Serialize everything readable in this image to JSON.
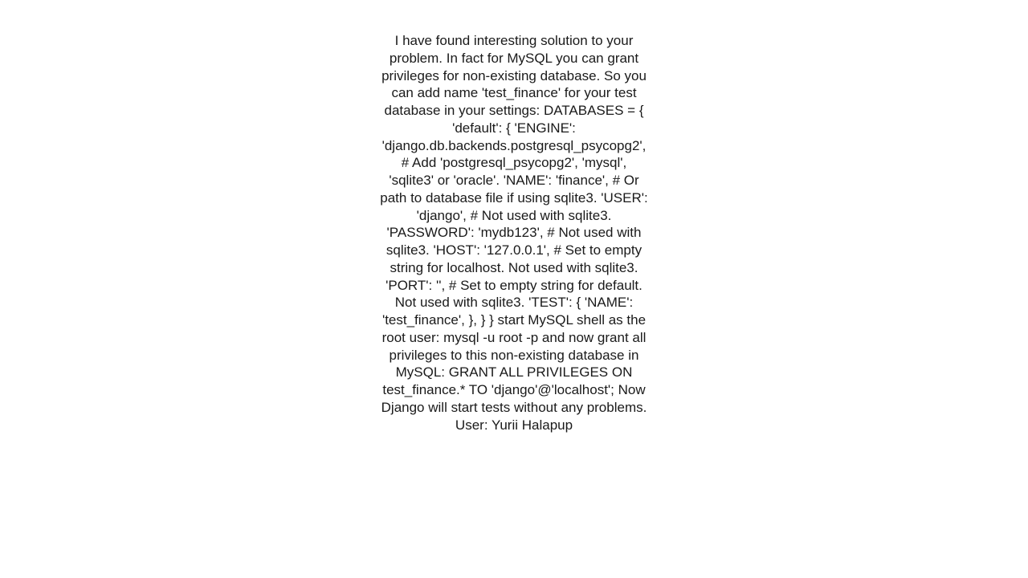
{
  "document": {
    "body": "I have found interesting solution to your problem.  In fact for MySQL you can grant privileges for non-existing database. So you can add name 'test_finance' for your test database in your settings:    DATABASES = {     'default': {         'ENGINE': 'django.db.backends.postgresql_psycopg2', # Add 'postgresql_psycopg2', 'mysql', 'sqlite3' or 'oracle'.         'NAME': 'finance',                      # Or path to database file if using sqlite3.         'USER': 'django',                      # Not used with sqlite3.         'PASSWORD': 'mydb123',                  # Not used with sqlite3.         'HOST': '127.0.0.1',                      # Set to empty string for localhost. Not used with sqlite3.         'PORT': '',                      # Set to empty string for default. Not used with sqlite3.         'TEST': {             'NAME': 'test_finance',         },     } }  start MySQL shell as the root user:    mysql -u root -p  and now grant all privileges to this non-existing database in MySQL: GRANT ALL PRIVILEGES ON test_finance.* TO 'django'@'localhost';  Now Django will start tests without any problems.  User: Yurii Halapup"
  }
}
